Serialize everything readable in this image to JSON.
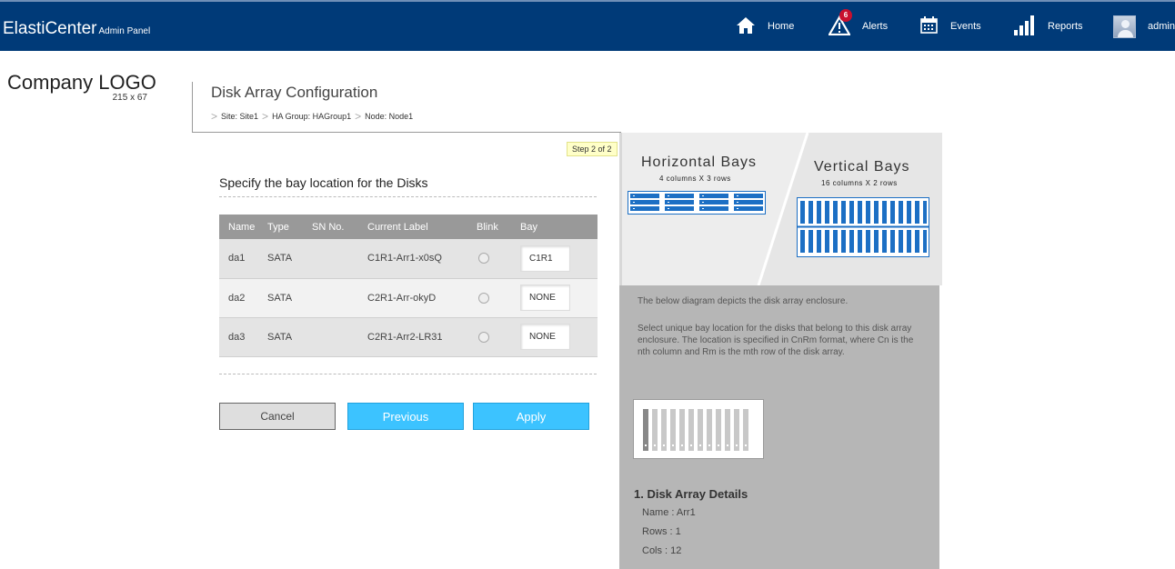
{
  "brand": {
    "name": "ElastiCenter",
    "subtitle": "Admin Panel"
  },
  "nav": {
    "home": "Home",
    "alerts": "Alerts",
    "alerts_count": "6",
    "events": "Events",
    "reports": "Reports",
    "user": "admin"
  },
  "logo": {
    "text": "Company LOGO",
    "size": "215 x 67"
  },
  "page": {
    "title": "Disk Array Configuration",
    "breadcrumb": [
      "Site: Site1",
      "HA Group: HAGroup1",
      "Node: Node1"
    ],
    "step": "Step 2 of 2",
    "section_title": "Specify the bay location for the Disks"
  },
  "table": {
    "columns": [
      "Name",
      "Type",
      "SN No.",
      "Current Label",
      "Blink",
      "Bay"
    ],
    "rows": [
      {
        "name": "da1",
        "type": "SATA",
        "sn": "",
        "label": "C1R1-Arr1-x0sQ",
        "bay": "C1R1"
      },
      {
        "name": "da2",
        "type": "SATA",
        "sn": "",
        "label": "C2R1-Arr-okyD",
        "bay": "NONE"
      },
      {
        "name": "da3",
        "type": "SATA",
        "sn": "",
        "label": "C2R1-Arr2-LR31",
        "bay": "NONE"
      }
    ]
  },
  "buttons": {
    "cancel": "Cancel",
    "previous": "Previous",
    "apply": "Apply"
  },
  "bays": {
    "horizontal_title": "Horizontal Bays",
    "horizontal_sub": "4 columns X 3 rows",
    "vertical_title": "Vertical Bays",
    "vertical_sub": "16 columns X 2 rows"
  },
  "help": {
    "line1": "The below diagram depicts the disk array enclosure.",
    "line2": "Select unique bay location for the disks that belong to this disk array enclosure. The location is specified in CnRm format, where Cn is the nth column and Rm is the mth row of the disk array."
  },
  "details": {
    "title": "1. Disk Array Details",
    "name": "Name : Arr1",
    "rows": "Rows : 1",
    "cols": "Cols : 12"
  },
  "colors": {
    "topbar": "#003a78",
    "accent_button": "#3cc3ff",
    "bay_blue": "#1c6fc4",
    "panel_gray": "#b6b6b6"
  }
}
